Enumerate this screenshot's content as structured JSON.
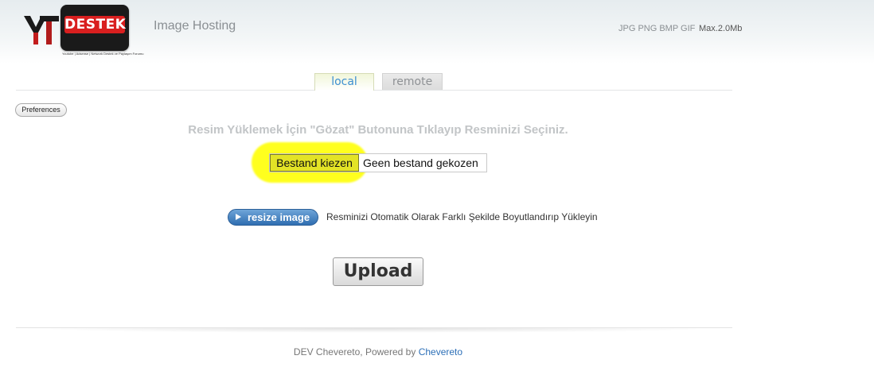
{
  "header": {
    "logo_text": "DESTEK",
    "logo_tagline": "Youtube | Adsense | Network Destek ve Paylaşım Forumu",
    "logo_mark": "YT",
    "app_title": "Image Hosting",
    "formats": "JPG PNG BMP GIF",
    "max_size": "Max.2.0Mb"
  },
  "tabs": [
    {
      "label": "local",
      "active": true
    },
    {
      "label": "remote",
      "active": false
    }
  ],
  "preferences_label": "Preferences",
  "instruction": "Resim Yüklemek İçin \"Gözat\" Butonuna Tıklayıp Resminizi Seçiniz.",
  "file_input": {
    "button_label": "Bestand kiezen",
    "status": "Geen bestand gekozen"
  },
  "resize": {
    "button_label": "resize image",
    "description": "Resminizi Otomatik Olarak Farklı Şekilde Boyutlandırıp Yükleyin"
  },
  "upload_label": "Upload",
  "footer": {
    "text": "DEV Chevereto, Powered by",
    "link": "Chevereto"
  },
  "colors": {
    "accent": "#3d8fd0",
    "highlight": "#ffff1e",
    "resize_button": "#2f6eb1",
    "link": "#2c6fb7"
  },
  "icons": {
    "resize_button_icon": "play-icon"
  }
}
